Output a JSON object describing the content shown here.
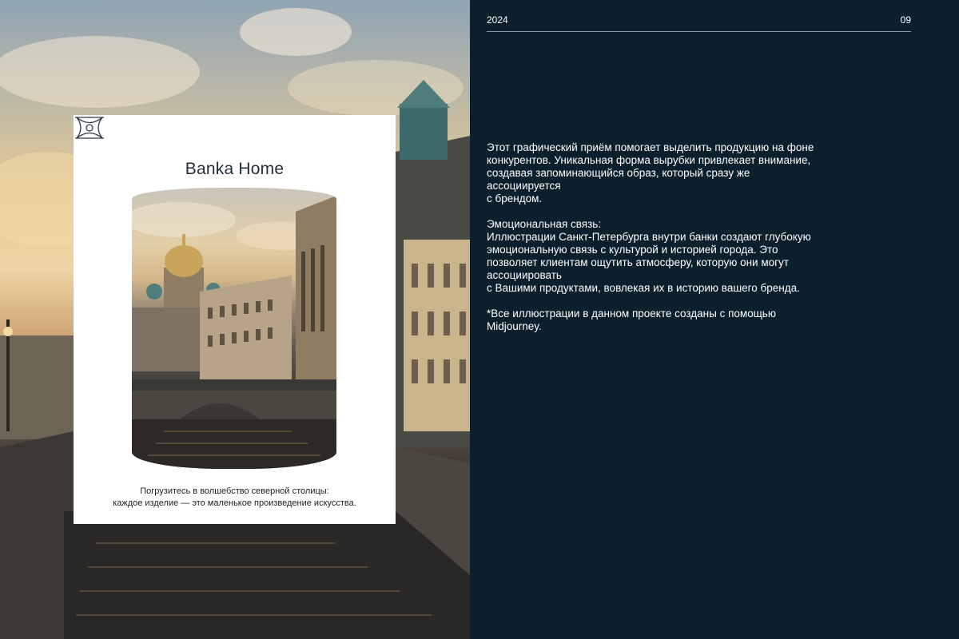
{
  "header": {
    "year": "2024",
    "page_number": "09"
  },
  "card": {
    "brand_name": "Banka Home",
    "caption_line1": "Погрузитесь в волшебство северной столицы:",
    "caption_line2": "каждое изделие — это маленькое произведение искусства."
  },
  "body": {
    "para1": [
      "Этот графический приём помогает выделить  продукцию на фоне",
      "конкурентов. Уникальная форма вырубки привлекает внимание,",
      "создавая запоминающийся образ, который сразу же",
      "ассоциируется",
      "с брендом."
    ],
    "para2": [
      "Эмоциональная связь:",
      "Иллюстрации Санкт-Петербурга внутри банки создают глубокую",
      "эмоциональную связь с культурой и историей города. Это",
      "позволяет клиентам ощутить атмосферу, которую они могут",
      "ассоциировать",
      "с Вашими продуктами, вовлекая их в историю вашего бренда."
    ],
    "para3": [
      "*Все иллюстрации в данном проекте созданы с помощью",
      "Midjourney."
    ]
  },
  "colors": {
    "panel_bg": "#0b1f2c",
    "card_bg": "#ffffff",
    "rule": "#8d9aa3"
  },
  "icons": {
    "logo": "ornamental-monogram-icon"
  }
}
